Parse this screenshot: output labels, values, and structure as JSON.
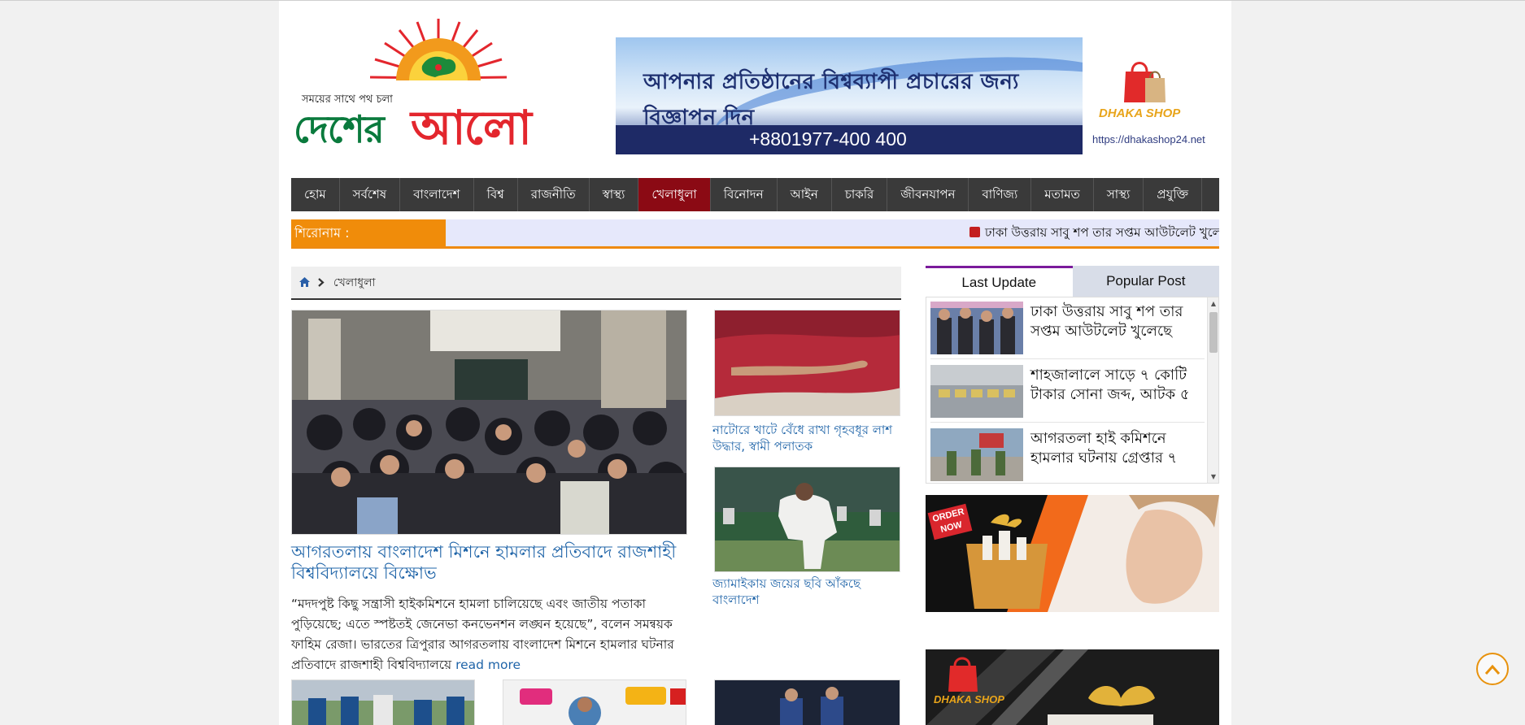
{
  "logo": {
    "tagline": "সময়ের সাথে পথ চলা",
    "name_part1": "দেশের",
    "name_part2": "আলো"
  },
  "ad_banner": {
    "headline": "আপনার প্রতিষ্ঠানের বিশ্বব্যাপী প্রচারের জন্য বিজ্ঞাপন দিন",
    "phone": "+8801977-400 400",
    "brand": "DHAKA SHOP",
    "url": "https://dhakashop24.net"
  },
  "nav": {
    "items": [
      {
        "label": "হোম"
      },
      {
        "label": "সর্বশেষ"
      },
      {
        "label": "বাংলাদেশ"
      },
      {
        "label": "বিশ্ব"
      },
      {
        "label": "রাজনীতি"
      },
      {
        "label": "স্বাস্থ্য"
      },
      {
        "label": "খেলাধুলা"
      },
      {
        "label": "বিনোদন"
      },
      {
        "label": "আইন"
      },
      {
        "label": "চাকরি"
      },
      {
        "label": "জীবনযাপন"
      },
      {
        "label": "বাণিজ্য"
      },
      {
        "label": "মতামত"
      },
      {
        "label": "সাস্থ্য"
      },
      {
        "label": "প্রযুক্তি"
      }
    ],
    "active_index": 6,
    "active_color": "#8b0a14"
  },
  "ticker": {
    "label": "শিরোনাম :",
    "text": "ঢাকা উত্তরায় সাবু শপ তার সপ্তম আউটলেট খুলেছে"
  },
  "breadcrumb": {
    "current": "খেলাধুলা"
  },
  "lead": {
    "title": "আগরতলায় বাংলাদেশ মিশনে হামলার প্রতিবাদে রাজশাহী বিশ্ববিদ্যালয়ে বিক্ষোভ",
    "body": "“মদদপুষ্ট কিছু সন্ত্রাসী হাইকমিশনে হামলা চালিয়েছে এবং জাতীয় পতাকা পুড়িয়েছে; এতে স্পষ্টতই জেনেভা কনভেনশন লঙ্ঘন হয়েছে”, বলেন সমন্বয়ক ফাহিম রেজা। ভারতের ত্রিপুরার আগরতলায় বাংলাদেশ মিশনে হামলার ঘটনার প্রতিবাদে রাজশাহী বিশ্ববিদ্যালয়ে",
    "read_more": "read more"
  },
  "side_cards": [
    {
      "title": "নাটোরে খাটে বেঁধে রাখা গৃহবধূর লাশ উদ্ধার, স্বামী পলাতক"
    },
    {
      "title": "জ্যামাইকায় জয়ের ছবি আঁকছে বাংলাদেশ"
    }
  ],
  "sidebar": {
    "tabs": [
      {
        "label": "Last Update"
      },
      {
        "label": "Popular Post"
      }
    ],
    "tab_accent": "#7a1a9b",
    "latest": [
      {
        "title": "ঢাকা উত্তরায় সাবু শপ তার সপ্তম আউটলেট খুলেছে"
      },
      {
        "title": "শাহজালালে সাড়ে ৭ কোটি টাকার সোনা জব্দ, আটক ৫"
      },
      {
        "title": "আগরতলা হাই কমিশনে হামলার ঘটনায় গ্রেপ্তার ৭"
      }
    ]
  },
  "ads": {
    "order_now": "ORDER NOW",
    "shop_brand": "DHAKA SHOP"
  },
  "icons": {
    "home": "home-icon",
    "chevron": "chevron-right-icon",
    "to_top": "chevron-up-icon"
  },
  "colors": {
    "ticker_label": "#f08c0a",
    "link": "#1f64a8",
    "nav_bg": "#3a3a3a"
  }
}
